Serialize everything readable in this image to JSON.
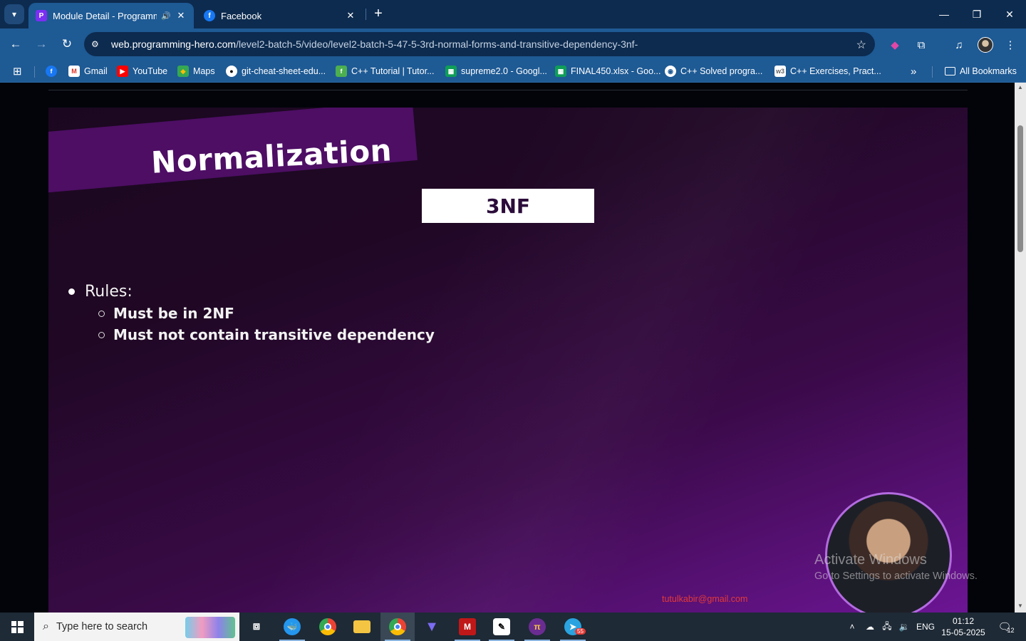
{
  "browser": {
    "tabs": [
      {
        "title": "Module Detail - Programmi",
        "favicon": "programming-hero-icon",
        "active": true,
        "audio": true
      },
      {
        "title": "Facebook",
        "favicon": "facebook-icon",
        "active": false
      }
    ],
    "url": {
      "host": "web.programming-hero.com",
      "path": "/level2-batch-5/video/level2-batch-5-47-5-3rd-normal-forms-and-transitive-dependency-3nf-"
    },
    "bookmarks": [
      {
        "label": "",
        "icon": "facebook-icon"
      },
      {
        "label": "Gmail",
        "icon": "gmail-icon"
      },
      {
        "label": "YouTube",
        "icon": "youtube-icon"
      },
      {
        "label": "Maps",
        "icon": "maps-icon"
      },
      {
        "label": "git-cheat-sheet-edu...",
        "icon": "github-icon"
      },
      {
        "label": "C++ Tutorial | Tutor...",
        "icon": "tutorial-icon"
      },
      {
        "label": "supreme2.0 - Googl...",
        "icon": "sheets-icon"
      },
      {
        "label": "FINAL450.xlsx - Goo...",
        "icon": "sheets-icon"
      },
      {
        "label": "C++ Solved progra...",
        "icon": "globe-icon"
      },
      {
        "label": "C++ Exercises, Pract...",
        "icon": "w3r-icon"
      }
    ],
    "all_bookmarks_label": "All Bookmarks",
    "overflow_label": "»"
  },
  "video": {
    "banner_title": "Normalization",
    "badge": "3NF",
    "rules_heading": "Rules:",
    "rules": [
      "Must be in 2NF",
      "Must not contain transitive dependency"
    ],
    "email": "tutulkabir@gmail.com",
    "watermark_line1": "Activate Windows",
    "watermark_line2": "Go to Settings to activate Windows."
  },
  "taskbar": {
    "search_placeholder": "Type here to search",
    "apps": [
      "task-view-icon",
      "docker-icon",
      "chrome-icon",
      "file-explorer-icon",
      "chrome-profile-icon",
      "vpn-icon",
      "mcafee-icon",
      "inkscape-icon",
      "pi-network-icon",
      "telegram-icon"
    ],
    "telegram_badge": "55",
    "language": "ENG",
    "time": "01:12",
    "date": "15-05-2025",
    "notification_count": "12"
  },
  "colors": {
    "tabstrip": "#0d2b4f",
    "toolbar": "#1e5a94",
    "banner": "#4d0e64",
    "email": "#e23a3a",
    "taskbar": "#1e2a36"
  }
}
